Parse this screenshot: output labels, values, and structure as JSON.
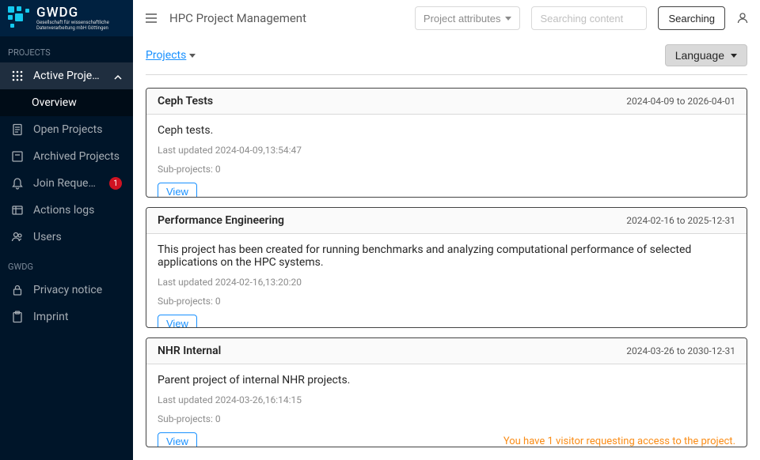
{
  "brand": {
    "name": "GWDG",
    "tagline1": "Gesellschaft für wissenschaftliche",
    "tagline2": "Datenverarbeitung mbH Göttingen"
  },
  "sidebar": {
    "section_projects": "PROJECTS",
    "section_gwdg": "GWDG",
    "items": {
      "active_projects": "Active Projects",
      "overview": "Overview",
      "open_projects": "Open Projects",
      "archived_projects": "Archived Projects",
      "join_requests": "Join Requests",
      "join_requests_badge": "1",
      "actions_logs": "Actions logs",
      "users": "Users",
      "privacy_notice": "Privacy notice",
      "imprint": "Imprint"
    }
  },
  "header": {
    "title": "HPC Project Management",
    "attributes_dropdown": "Project attributes",
    "search_placeholder": "Searching content",
    "search_button": "Searching"
  },
  "subheader": {
    "breadcrumb": "Projects",
    "language_button": "Language"
  },
  "projects": [
    {
      "title": "Ceph Tests",
      "dates": "2024-04-09 to 2026-04-01",
      "description": "Ceph tests.",
      "last_updated": "Last updated 2024-04-09,13:54:47",
      "sub_projects": "Sub-projects: 0",
      "view_label": "View",
      "visitor_notice": ""
    },
    {
      "title": "Performance Engineering",
      "dates": "2024-02-16 to 2025-12-31",
      "description": "This project has been created for running benchmarks and analyzing computational performance of selected applications on the HPC systems.",
      "last_updated": "Last updated 2024-02-16,13:20:20",
      "sub_projects": "Sub-projects: 0",
      "view_label": "View",
      "visitor_notice": ""
    },
    {
      "title": "NHR Internal",
      "dates": "2024-03-26 to 2030-12-31",
      "description": "Parent project of internal NHR projects.",
      "last_updated": "Last updated 2024-03-26,16:14:15",
      "sub_projects": "Sub-projects: 0",
      "view_label": "View",
      "visitor_notice": "You have 1 visitor requesting access to the project."
    }
  ]
}
